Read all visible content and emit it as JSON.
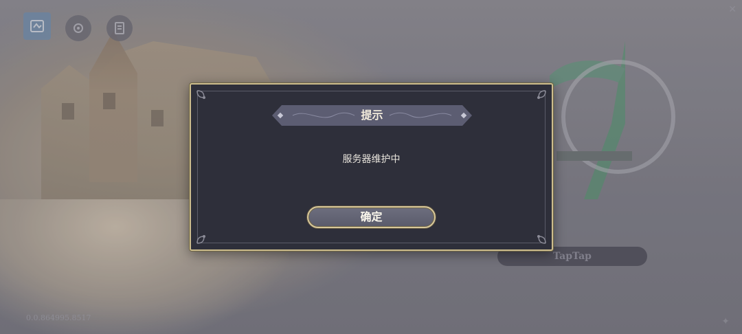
{
  "background": {
    "login_button_label": "TapTap",
    "version_text": "0.0.864995.8517"
  },
  "top_icons": [
    {
      "icon": "game-logo-icon"
    },
    {
      "icon": "settings-gear-icon"
    },
    {
      "icon": "notice-document-icon"
    }
  ],
  "dialog": {
    "title": "提示",
    "message": "服务器维护中",
    "confirm_label": "确定"
  },
  "colors": {
    "dialog_bg": "#2e2f3a",
    "dialog_border_gold": "#cdbd8e",
    "title_plate": "#5c5d72",
    "button_fill": "#62637a",
    "text_light": "#f3ecdc"
  }
}
